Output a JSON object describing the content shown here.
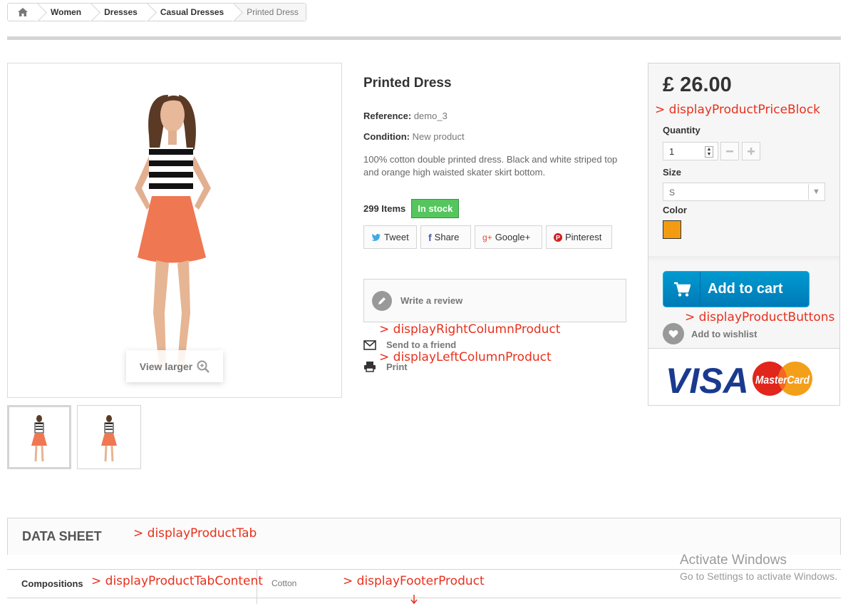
{
  "breadcrumb": {
    "home_icon": "home-icon",
    "items": [
      "Women",
      "Dresses",
      "Casual Dresses"
    ],
    "current": "Printed Dress"
  },
  "product": {
    "title": "Printed Dress",
    "reference_label": "Reference:",
    "reference_value": "demo_3",
    "condition_label": "Condition:",
    "condition_value": "New product",
    "description": "100% cotton double printed dress. Black and white striped top and orange high waisted skater skirt bottom.",
    "items_count": "299 Items",
    "stock_badge": "In stock",
    "view_larger": "View larger"
  },
  "social": {
    "tweet": "Tweet",
    "share": "Share",
    "google": "Google+",
    "pinterest": "Pinterest"
  },
  "actions": {
    "write_review": "Write a review",
    "send_friend": "Send to a friend",
    "print": "Print"
  },
  "buy_box": {
    "price": "£ 26.00",
    "quantity_label": "Quantity",
    "quantity_value": "1",
    "size_label": "Size",
    "size_value": "S",
    "color_label": "Color",
    "color_value": "#f39c11",
    "add_to_cart": "Add to cart",
    "add_to_wishlist": "Add to wishlist",
    "payment_visa": "VISA",
    "payment_mastercard": "MasterCard"
  },
  "hooks": {
    "price_block": "> displayProductPriceBlock",
    "right_column": "> displayRightColumnProduct",
    "left_column": "> displayLeftColumnProduct",
    "buttons": "> displayProductButtons",
    "tab": "> displayProductTab",
    "tab_content": "> displayProductTabContent",
    "footer": "> displayFooterProduct"
  },
  "tabs": {
    "data_sheet": "DATA SHEET",
    "compositions_label": "Compositions",
    "compositions_value": "Cotton"
  },
  "watermark": {
    "line1": "Activate Windows",
    "line2": "Go to Settings to activate Windows."
  },
  "colors": {
    "accent_red": "#e8301c",
    "stock_green": "#55c65e",
    "cart_blue": "#0082c3"
  }
}
